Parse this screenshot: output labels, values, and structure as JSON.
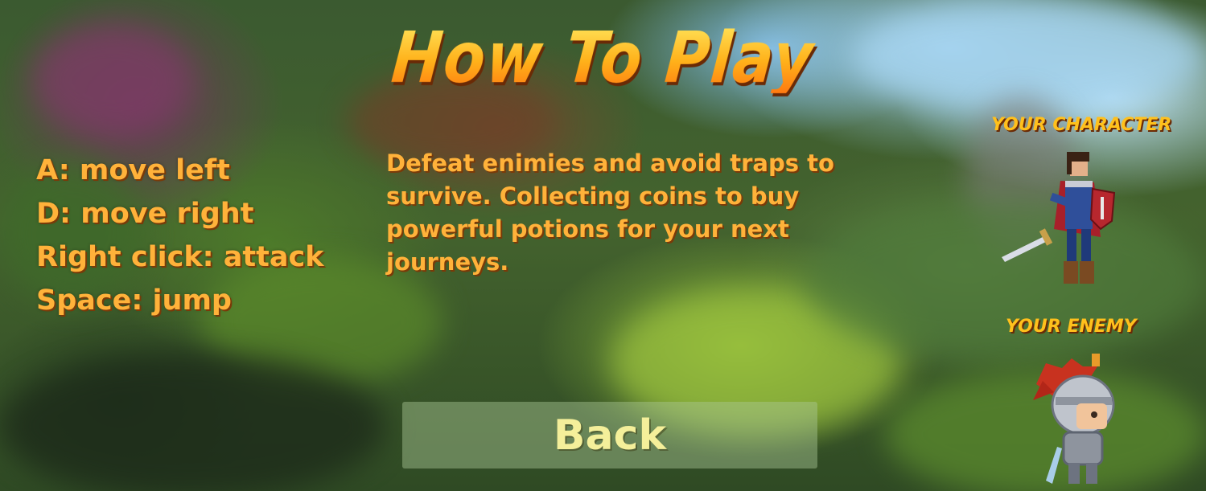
{
  "screen": {
    "title": "How To Play",
    "controls": [
      "A: move left",
      "D: move right",
      "Right click: attack",
      "Space: jump"
    ],
    "description": "Defeat enimies and avoid traps to survive. Collecting coins to buy powerful potions for your next journeys.",
    "character_label": "Your character",
    "enemy_label": "Your enemy",
    "back_label": "Back"
  },
  "colors": {
    "title_gold": "#ffc21c",
    "text_orange": "#ffb23a",
    "back_text": "#f4ef9a"
  },
  "icons": {
    "character": "hero-knight-sprite",
    "enemy": "red-plume-knight-sprite"
  }
}
